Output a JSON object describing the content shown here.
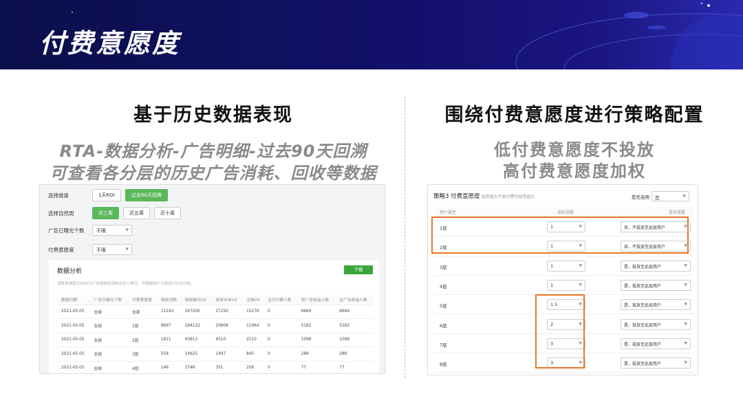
{
  "title": "付费意愿度",
  "left": {
    "heading": "基于历史数据表现",
    "sub1": "RTA-数据分析-广告明细-过去90天回溯",
    "sub2": "可查看各分层的历史广告消耗、回收等数据",
    "filters": {
      "dimension_label": "选择维度",
      "dimension_options": [
        "1天ROI",
        "过去90天回溯"
      ],
      "week_label": "选择自然周",
      "week_options": [
        "近三周",
        "近五周",
        "近十周"
      ],
      "exposure_label": "广告已曝光个数",
      "exposure_value": "不限",
      "willingness_label": "付费意愿度",
      "willingness_value": "不限"
    },
    "panel": {
      "title": "数据分析",
      "download": "下载",
      "note": "调整表弹窗过去90天广告投放的消耗及收入情况，可根据用户分层进行比对分析。",
      "columns": [
        "数据日期",
        "广告已曝光个数",
        "付费意愿度",
        "投放消耗",
        "投放曝光UV",
        "投放点击UV",
        "注册UV",
        "当日付费人数",
        "有广告收益人数",
        "含广告收益人数"
      ],
      "rows": [
        [
          "2021-05-05",
          "全部",
          "全部",
          "11243",
          "247200",
          "27250",
          "15276",
          "0",
          "6664",
          "6664"
        ],
        [
          "2021-05-05",
          "全部",
          "1层",
          "8697",
          "184122",
          "20808",
          "11964",
          "0",
          "5182",
          "5182"
        ],
        [
          "2021-05-05",
          "全部",
          "2层",
          "1811",
          "43813",
          "4510",
          "2510",
          "0",
          "1098",
          "1098"
        ],
        [
          "2021-05-05",
          "全部",
          "3层",
          "558",
          "14625",
          "1497",
          "845",
          "0",
          "288",
          "288"
        ],
        [
          "2021-05-05",
          "全部",
          "4层",
          "146",
          "3748",
          "351",
          "206",
          "0",
          "77",
          "77"
        ]
      ]
    }
  },
  "right": {
    "heading": "围绕付费意愿度进行策略配置",
    "sub1": "低付费意愿度不投放",
    "sub2": "高付费意愿度加权",
    "panel": {
      "title": "策略3 付费意愿度",
      "note": "层数越大代表付费可能性越大",
      "enable_label": "是否启用",
      "enable_value": "是",
      "columns": [
        "用户属性",
        "调权倍数",
        "是否需要"
      ],
      "rows": [
        {
          "layer": "1层",
          "multiplier": "1",
          "choice": "否，不投放至此层用户"
        },
        {
          "layer": "2层",
          "multiplier": "1",
          "choice": "否，不投放至此层用户"
        },
        {
          "layer": "3层",
          "multiplier": "1",
          "choice": "是，投放至此层用户"
        },
        {
          "layer": "4层",
          "multiplier": "1",
          "choice": "是，投放至此层用户"
        },
        {
          "layer": "5层",
          "multiplier": "1.5",
          "choice": "是，投放至此层用户"
        },
        {
          "layer": "6层",
          "multiplier": "2",
          "choice": "是，投放至此层用户"
        },
        {
          "layer": "7层",
          "multiplier": "3",
          "choice": "是，投放至此层用户"
        },
        {
          "layer": "8层",
          "multiplier": "3",
          "choice": "是，投放至此层用户"
        }
      ]
    }
  },
  "colors": {
    "banner": "#12106b",
    "accent_green": "#5bb75b",
    "highlight": "#e8762a"
  }
}
